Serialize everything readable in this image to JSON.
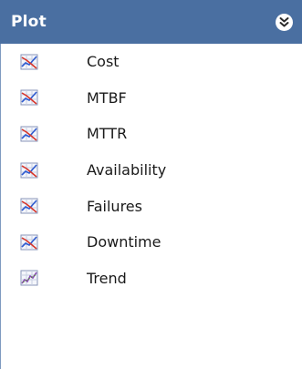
{
  "panel": {
    "title": "Plot",
    "collapse_icon": "double-chevron-down-icon"
  },
  "items": [
    {
      "label": "Cost",
      "icon": "chart-icon"
    },
    {
      "label": "MTBF",
      "icon": "chart-icon"
    },
    {
      "label": "MTTR",
      "icon": "chart-icon"
    },
    {
      "label": "Availability",
      "icon": "chart-icon"
    },
    {
      "label": "Failures",
      "icon": "chart-icon"
    },
    {
      "label": "Downtime",
      "icon": "chart-icon"
    },
    {
      "label": "Trend",
      "icon": "trend-chart-icon"
    }
  ],
  "colors": {
    "header_bg": "#4a6fa1",
    "header_text": "#ffffff",
    "item_text": "#1a1a1a"
  }
}
